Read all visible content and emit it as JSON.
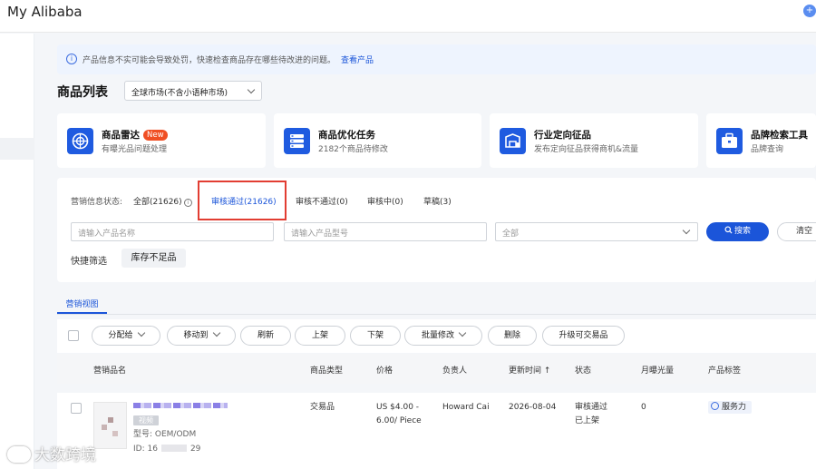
{
  "app": {
    "title": "My Alibaba"
  },
  "notice": {
    "text": "产品信息不实可能会导致处罚，快速检查商品存在哪些待改进的问题。",
    "link": "查看产品"
  },
  "page": {
    "title": "商品列表",
    "market_select": "全球市场(不含小语种市场)"
  },
  "tools": [
    {
      "title": "商品雷达",
      "badge": "New",
      "subtitle": "有曝光品问题处理",
      "icon": "radar-icon"
    },
    {
      "title": "商品优化任务",
      "subtitle": "2182个商品待修改",
      "icon": "task-list-icon"
    },
    {
      "title": "行业定向征品",
      "subtitle": "发布定向征品获得商机&流量",
      "icon": "targeted-collection-icon"
    },
    {
      "title": "品牌检索工具",
      "subtitle": "品牌查询",
      "icon": "briefcase-icon"
    }
  ],
  "status_filter": {
    "label": "营销信息状态:",
    "tabs": [
      "全部(21626)",
      "审核通过(21626)",
      "审核不通过(0)",
      "审核中(0)",
      "草稿(3)"
    ],
    "active_index": 1
  },
  "search": {
    "name_placeholder": "请输入产品名称",
    "model_placeholder": "请输入产品型号",
    "category_value": "全部",
    "search_label": "搜索",
    "clear_label": "清空"
  },
  "quick_filter": {
    "label": "快捷筛选",
    "chip": "库存不足品"
  },
  "view_tab": "营销视图",
  "actions": [
    "分配给",
    "移动到",
    "刷新",
    "上架",
    "下架",
    "批量修改",
    "删除",
    "升级可交易品"
  ],
  "table": {
    "columns": [
      "营销品名",
      "商品类型",
      "价格",
      "负责人",
      "更新时间",
      "状态",
      "月曝光量",
      "产品标签"
    ],
    "sort_arrow": "↑",
    "rows": [
      {
        "tag": "视频",
        "model": "型号: OEM/ODM",
        "id_prefix": "ID: 16",
        "id_suffix": "29",
        "type": "交易品",
        "price_line1": "US $4.00 -",
        "price_line2": "6.00/ Piece",
        "owner": "Howard Cai",
        "updated": "2026-08-04",
        "status_line1": "审核通过",
        "status_line2": "已上架",
        "monthly_exposure": "0",
        "product_tag": "服务力"
      }
    ]
  },
  "watermark": "大数跨境",
  "colors": {
    "accent": "#1b55d9",
    "highlight": "#e23d32",
    "new_badge": "#f04e23"
  }
}
